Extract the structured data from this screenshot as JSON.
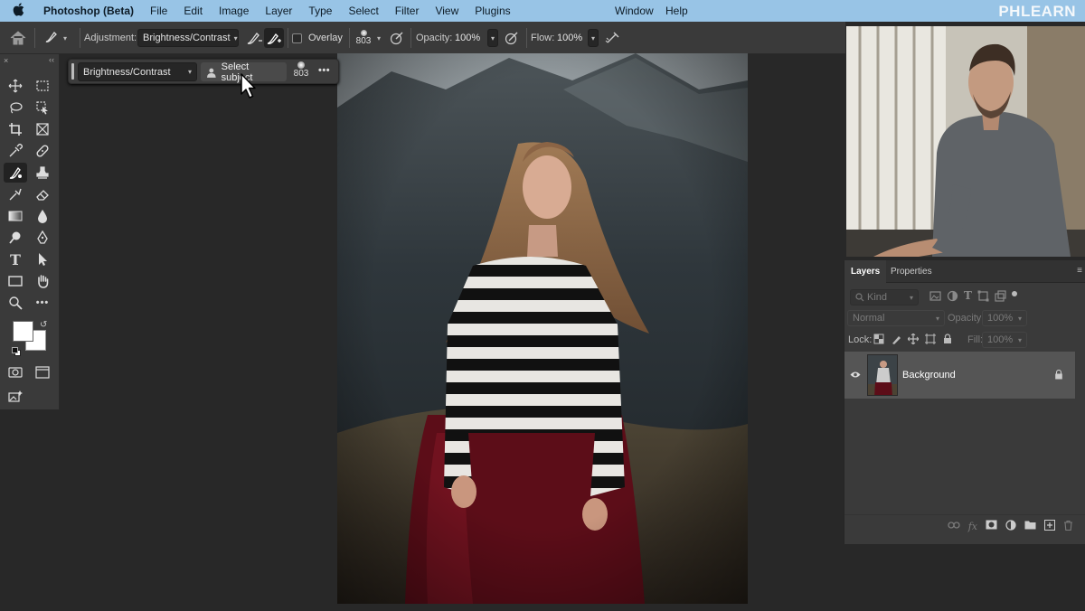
{
  "menubar": {
    "app_name": "Photoshop (Beta)",
    "items": [
      "File",
      "Edit",
      "Image",
      "Layer",
      "Type",
      "Select",
      "Filter",
      "View",
      "Plugins"
    ],
    "right_items": [
      "Window",
      "Help"
    ],
    "brand": "PHLEARN"
  },
  "options_bar": {
    "adjustment_label": "Adjustment:",
    "adjustment_value": "Brightness/Contrast",
    "overlay_label": "Overlay",
    "brush_size": "803",
    "opacity_label": "Opacity:",
    "opacity_value": "100%",
    "flow_label": "Flow:",
    "flow_value": "100%"
  },
  "context_bar": {
    "adjustment_value": "Brightness/Contrast",
    "select_subject_label": "Select subject",
    "brush_size": "803",
    "more_label": "•••"
  },
  "layers_panel": {
    "tabs": [
      "Layers",
      "Properties"
    ],
    "kind_label": "Kind",
    "blend_mode": "Normal",
    "opacity_label": "Opacity:",
    "opacity_value": "100%",
    "lock_label": "Lock:",
    "fill_label": "Fill:",
    "fill_value": "100%",
    "layers": [
      {
        "name": "Background",
        "visible": true,
        "locked": true
      }
    ]
  },
  "colors": {
    "menubar_bg": "#98c4e6",
    "panel_bg": "#3a3a3a",
    "workspace_bg": "#282828",
    "selected_layer_bg": "#555555"
  }
}
